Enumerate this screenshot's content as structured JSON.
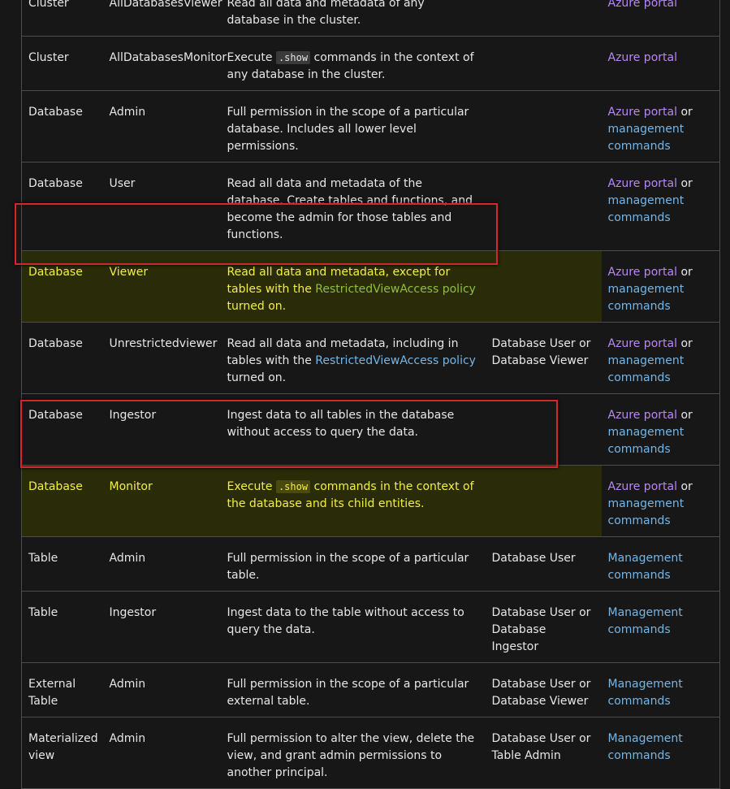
{
  "rows": [
    {
      "scope": "Cluster",
      "role": "AllDatabasesViewer",
      "desc_a": "Read all data and metadata of any database in",
      "desc_b": "the cluster.",
      "assign": "",
      "portal": "Azure portal",
      "or": "",
      "mgmt": "",
      "mgmt_b": ""
    },
    {
      "scope": "Cluster",
      "role": "AllDatabasesMonitor",
      "desc_pre": "Execute",
      "code": ".show",
      "desc_post": "commands in the context of any database in the cluster.",
      "assign": "",
      "portal": "Azure portal"
    },
    {
      "scope": "Database",
      "role": "Admin",
      "desc": "Full permission in the scope of a particular database. Includes all lower level permissions.",
      "assign": "",
      "portal": "Azure portal",
      "or": "or",
      "mgmt": "management",
      "mgmt_b": "commands"
    },
    {
      "scope": "Database",
      "role": "User",
      "desc": "Read all data and metadata of the database. Create tables and functions, and become the admin for those tables and functions.",
      "assign": "",
      "portal": "Azure portal",
      "or": "or",
      "mgmt": "management",
      "mgmt_b": "commands"
    },
    {
      "scope": "Database",
      "role": "Viewer",
      "desc_pre": "Read all data and metadata, except for tables with the",
      "link": "RestrictedViewAccess policy",
      "desc_post": "turned on.",
      "assign": "",
      "portal": "Azure portal",
      "or": "or",
      "mgmt": "management",
      "mgmt_b": "commands"
    },
    {
      "scope": "Database",
      "role": "Unrestrictedviewer",
      "desc_pre": "Read all data and metadata, including in tables with the",
      "link": "RestrictedViewAccess policy",
      "desc_post": "turned on.",
      "assign": "Database User or Database Viewer",
      "portal": "Azure portal",
      "or": "or",
      "mgmt": "management",
      "mgmt_b": "commands"
    },
    {
      "scope": "Database",
      "role": "Ingestor",
      "desc": "Ingest data to all tables in the database without access to query the data.",
      "assign": "",
      "portal": "Azure portal",
      "or": "or",
      "mgmt": "management",
      "mgmt_b": "commands"
    },
    {
      "scope": "Database",
      "role": "Monitor",
      "desc_pre": "Execute",
      "code": ".show",
      "desc_post": "commands in the context of the database and its child entities.",
      "assign": "",
      "portal": "Azure portal",
      "or": "or",
      "mgmt": "management",
      "mgmt_b": "commands"
    },
    {
      "scope": "Table",
      "role": "Admin",
      "desc": "Full permission in the scope of a particular table.",
      "assign": "Database User",
      "mgmt": "Management",
      "mgmt_b": "commands"
    },
    {
      "scope": "Table",
      "role": "Ingestor",
      "desc": "Ingest data to the table without access to query the data.",
      "assign": "Database User or Database Ingestor",
      "mgmt": "Management",
      "mgmt_b": "commands"
    },
    {
      "scope": "External Table",
      "role": "Admin",
      "desc": "Full permission in the scope of a particular external table.",
      "assign": "Database User or Database Viewer",
      "mgmt": "Management",
      "mgmt_b": "commands"
    },
    {
      "scope": "Materialized view",
      "role": "Admin",
      "desc": "Full permission to alter the view, delete the view, and grant admin permissions to another principal.",
      "assign": "Database User or Table Admin",
      "mgmt": "Management",
      "mgmt_b": "commands"
    }
  ],
  "colors": {
    "highlight_bg": "#2a2b08",
    "highlight_text": "#f2ef43",
    "red_box": "#d4272c",
    "link_purple": "#b987f5",
    "link_blue": "#75b6e7"
  }
}
